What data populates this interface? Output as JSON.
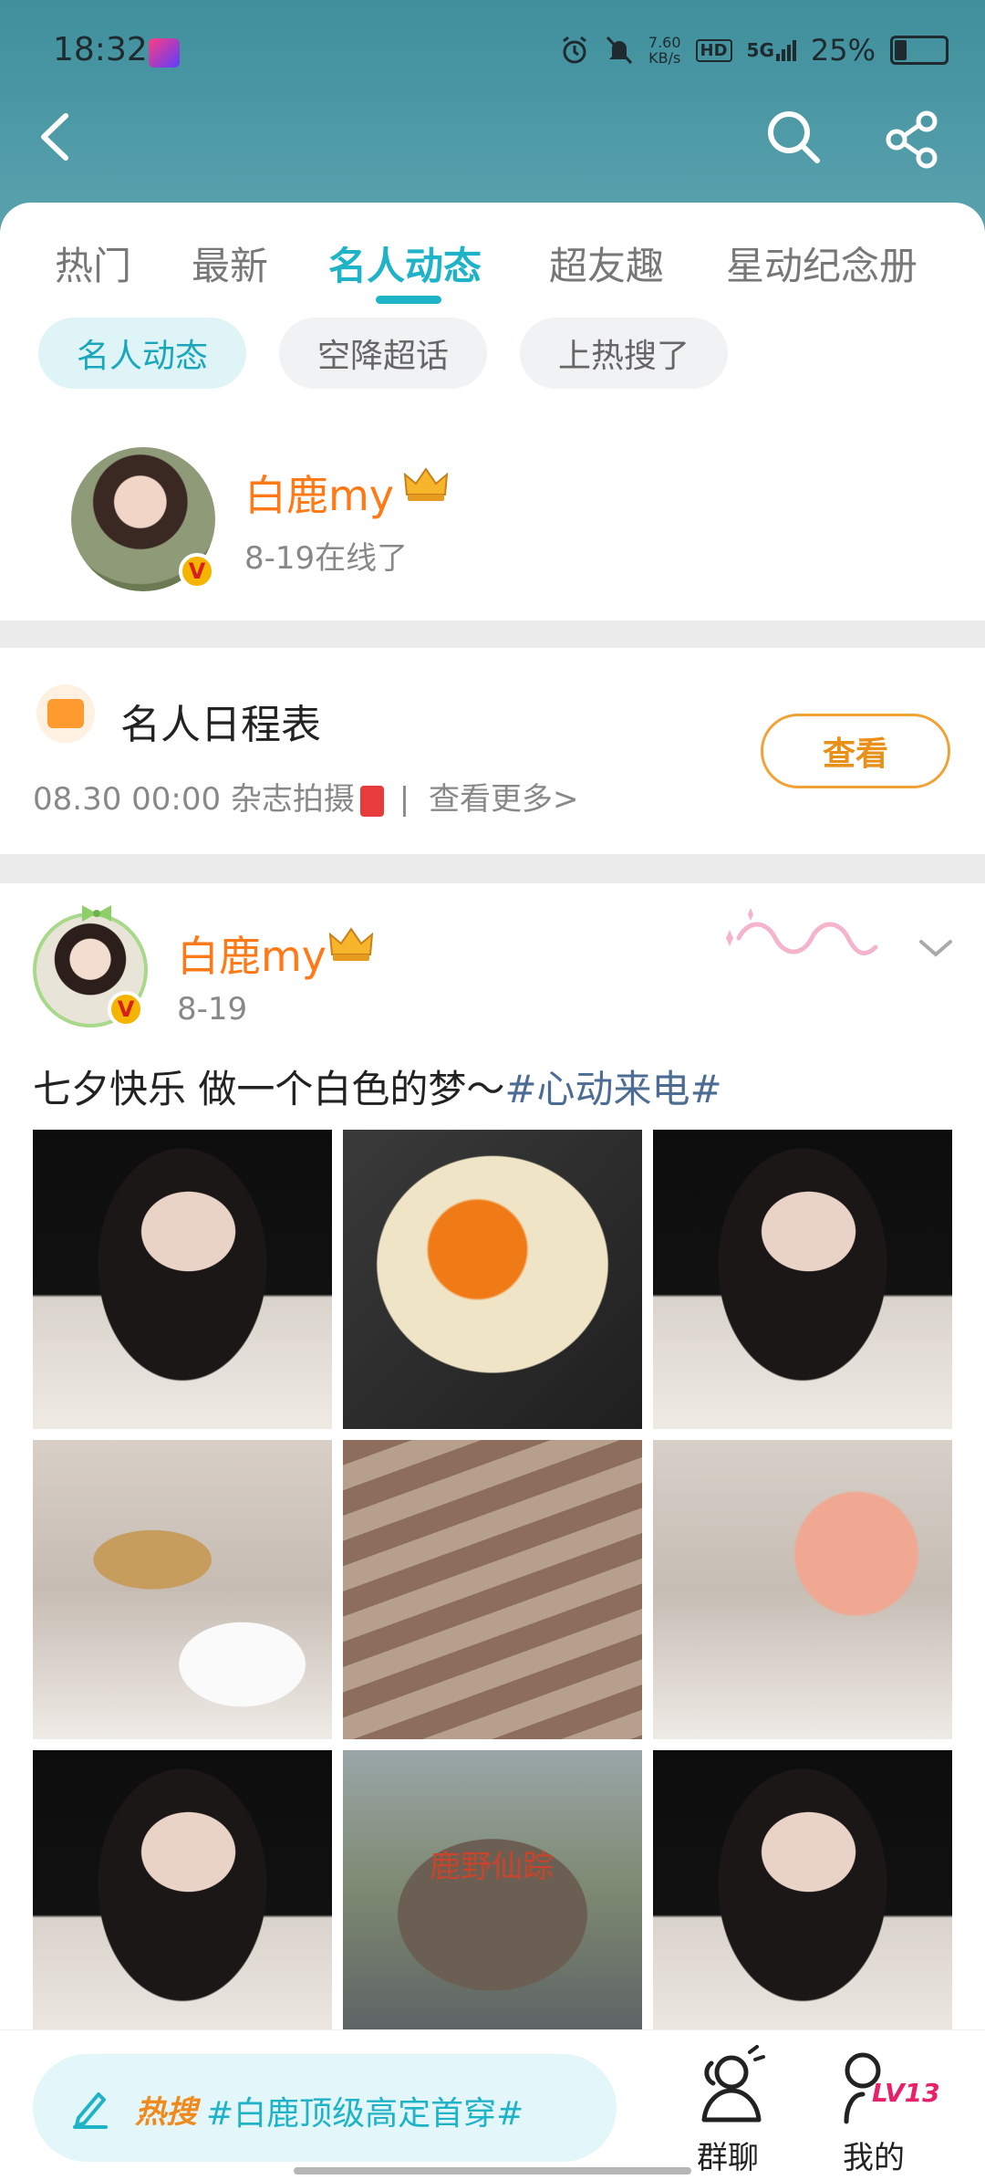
{
  "status_bar": {
    "time": "18:32",
    "net_speed_value": "7.60",
    "net_speed_unit": "KB/s",
    "hd_label": "HD",
    "network_label": "5G",
    "battery_percent": "25%",
    "battery_level": 0.25
  },
  "tabs": [
    {
      "label": "热门",
      "active": false
    },
    {
      "label": "最新",
      "active": false
    },
    {
      "label": "名人动态",
      "active": true
    },
    {
      "label": "超友趣",
      "active": false
    },
    {
      "label": "星动纪念册",
      "active": false
    }
  ],
  "filter_chips": [
    {
      "label": "名人动态",
      "active": true
    },
    {
      "label": "空降超话",
      "active": false
    },
    {
      "label": "上热搜了",
      "active": false
    }
  ],
  "celebrity": {
    "name": "白鹿my",
    "online_status": "8-19在线了",
    "verified_mark": "V"
  },
  "schedule": {
    "title": "名人日程表",
    "entry": "08.30 00:00 杂志拍摄",
    "separator": "|",
    "more_link": "查看更多>",
    "view_button": "查看"
  },
  "post": {
    "author": "白鹿my",
    "date": "8-19",
    "text": "七夕快乐 做一个白色的梦～",
    "hashtag": "#心动来电#",
    "verified_mark": "V",
    "photos": [
      {
        "kind": "portrait-dark"
      },
      {
        "kind": "heart-egg"
      },
      {
        "kind": "portrait-dark"
      },
      {
        "kind": "room-sign"
      },
      {
        "kind": "stairs"
      },
      {
        "kind": "room-chibi"
      },
      {
        "kind": "portrait-dark"
      },
      {
        "kind": "wooden-sign"
      },
      {
        "kind": "portrait-dark"
      }
    ],
    "sign_text": "鹿野仙踪"
  },
  "bottom_bar": {
    "hot_label": "热搜",
    "hot_topic": "#白鹿顶级高定首穿#",
    "group_chat": "群聊",
    "mine": "我的",
    "level_badge": "LV13"
  },
  "colors": {
    "header": "#4a98a4",
    "accent": "#1fb3c8",
    "orange_name": "#ff7a16",
    "hashtag": "#4d6c94"
  },
  "icons": [
    "back-arrow-icon",
    "search-icon",
    "share-icon",
    "calendar-icon",
    "crown-icon",
    "chevron-down-icon",
    "pen-icon",
    "group-chat-icon",
    "profile-icon"
  ]
}
